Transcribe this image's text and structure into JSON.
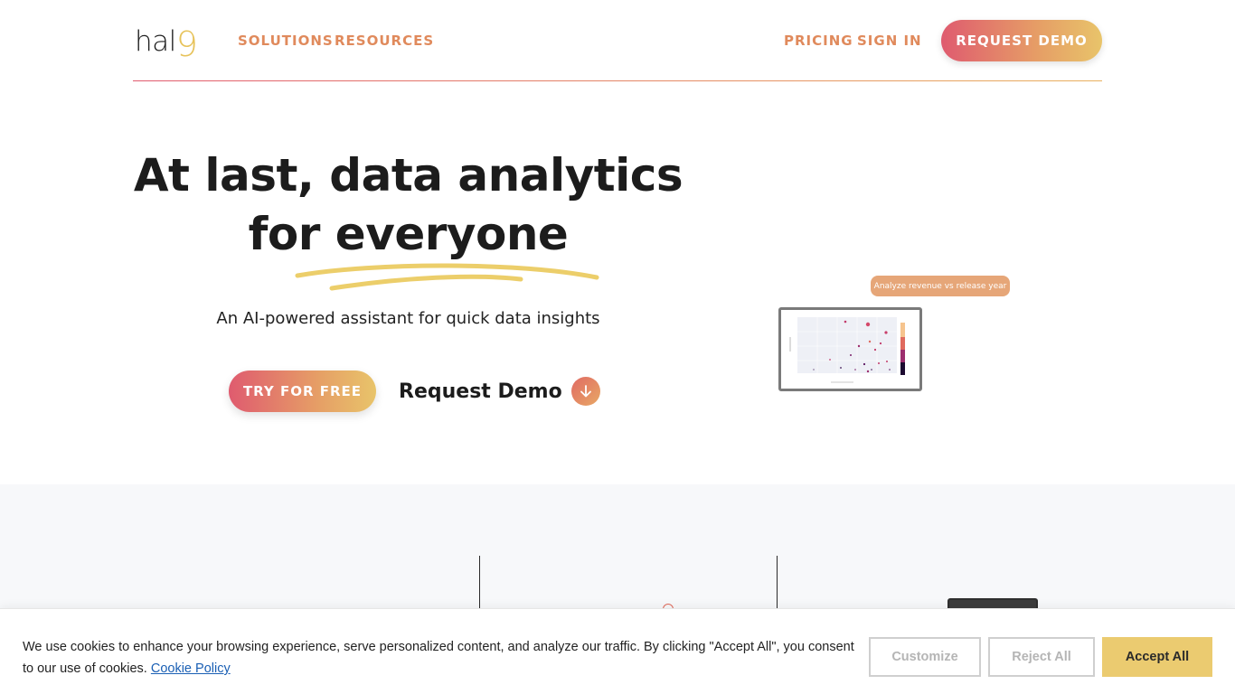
{
  "header": {
    "logo_text": "hal",
    "logo_nine": "9",
    "nav": {
      "solutions": "SOLUTIONS",
      "resources": "RESOURCES",
      "pricing": "PRICING",
      "sign_in": "SIGN IN"
    },
    "request_demo": "REQUEST DEMO"
  },
  "hero": {
    "title_line1": "At last, data analytics",
    "title_line2": "for everyone",
    "subtitle": "An AI-powered assistant for quick data insights",
    "try_free": "TRY FOR FREE",
    "request_demo": "Request Demo"
  },
  "mockup": {
    "chat_prompt": "Analyze revenue vs release year"
  },
  "cookie_banner": {
    "text": "We use cookies to enhance your browsing experience, serve personalized  content, and analyze our traffic. By clicking \"Accept All\", you consent to our use of cookies. ",
    "policy_link": "Cookie Policy",
    "customize": "Customize",
    "reject_all": "Reject All",
    "accept_all": "Accept All"
  },
  "colors": {
    "accent_orange": "#e08a5c",
    "gradient_start": "#df5b6f",
    "gradient_end": "#e8c46a",
    "accept_yellow": "#ebcb70",
    "logo_nine": "#e7c35b"
  }
}
